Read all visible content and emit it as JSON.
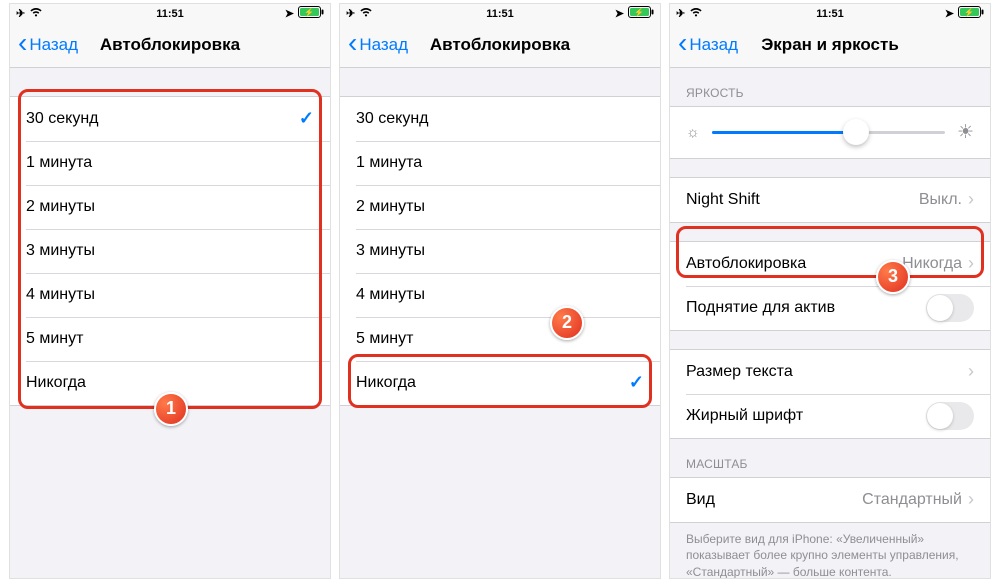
{
  "status": {
    "time": "11:51",
    "airplane_glyph": "✈",
    "wifi_glyph": "⚞",
    "loc_glyph": "➤",
    "charge_glyph": "⚡",
    "battery_glyph": "▮▮▯"
  },
  "nav": {
    "back": "Назад",
    "chevron": "‹"
  },
  "screen1": {
    "title": "Автоблокировка",
    "options": [
      "30 секунд",
      "1 минута",
      "2 минуты",
      "3 минуты",
      "4 минуты",
      "5 минут",
      "Никогда"
    ],
    "selected_index": 0,
    "badge": "1"
  },
  "screen2": {
    "title": "Автоблокировка",
    "options": [
      "30 секунд",
      "1 минута",
      "2 минуты",
      "3 минуты",
      "4 минуты",
      "5 минут",
      "Никогда"
    ],
    "selected_index": 6,
    "badge": "2"
  },
  "screen3": {
    "title": "Экран и яркость",
    "brightness_header": "ЯРКОСТЬ",
    "sun_small": "☼",
    "sun_big": "☀",
    "brightness_percent": 62,
    "night_shift_label": "Night Shift",
    "night_shift_value": "Выкл.",
    "autolock_label": "Автоблокировка",
    "autolock_value": "Никогда",
    "raise_label": "Поднятие для актив",
    "text_size_label": "Размер текста",
    "bold_label": "Жирный шрифт",
    "zoom_header": "МАСШТАБ",
    "view_label": "Вид",
    "view_value": "Стандартный",
    "footer": "Выберите вид для iPhone: «Увеличенный» показывает более крупно элементы управления, «Стандартный» — больше контента.",
    "badge": "3"
  },
  "checkmark": "✓",
  "chev_right": "›"
}
